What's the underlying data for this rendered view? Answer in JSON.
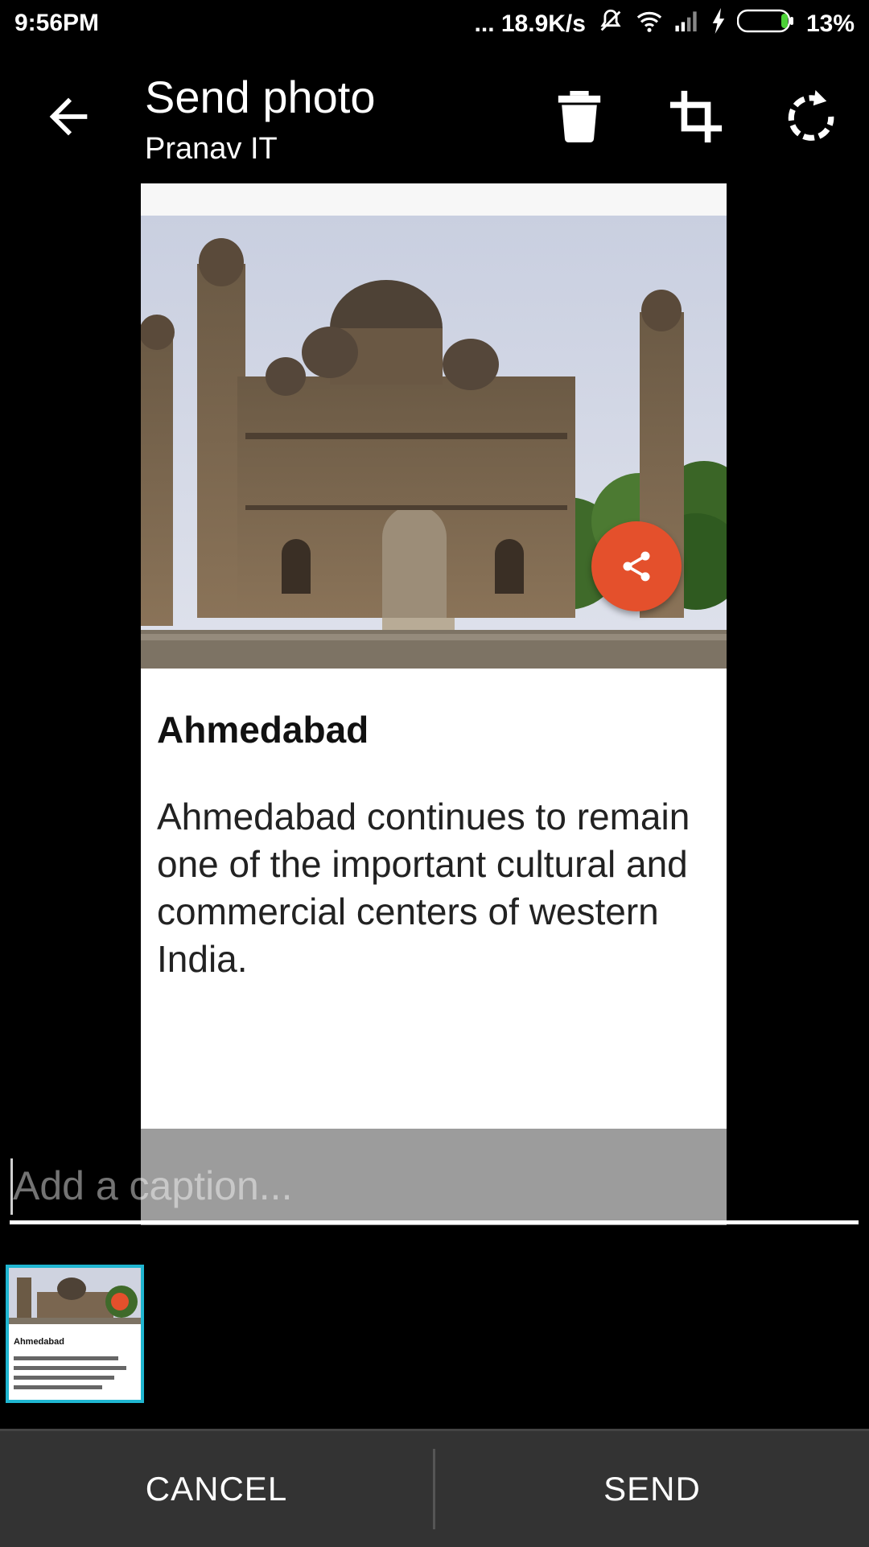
{
  "status_bar": {
    "time": "9:56PM",
    "network_speed": "... 18.9K/s",
    "battery": "13%",
    "icons": [
      "mute-icon",
      "wifi-icon",
      "signal-icon",
      "charging-icon",
      "battery-icon"
    ]
  },
  "header": {
    "title": "Send photo",
    "subtitle": "Pranav IT",
    "actions": [
      "delete-icon",
      "crop-icon",
      "rotate-icon"
    ]
  },
  "card": {
    "title": "Ahmedabad",
    "body": "Ahmedabad continues to remain one of the important cultural and commercial centers of western India.",
    "accent_color": "#e4502c"
  },
  "caption": {
    "placeholder": "Add a caption..."
  },
  "thumbnail": {
    "title": "Ahmedabad",
    "border_color": "#1fb6d1"
  },
  "bottom_bar": {
    "cancel_label": "CANCEL",
    "send_label": "SEND"
  }
}
